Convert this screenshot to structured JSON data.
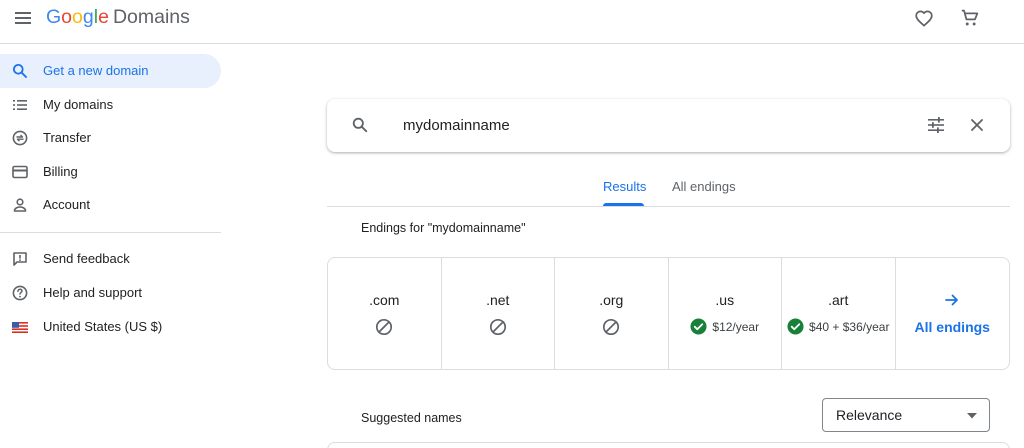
{
  "header": {
    "logo_letters": [
      {
        "char": "G",
        "color": "#4285F4"
      },
      {
        "char": "o",
        "color": "#EA4335"
      },
      {
        "char": "o",
        "color": "#FBBC05"
      },
      {
        "char": "g",
        "color": "#4285F4"
      },
      {
        "char": "l",
        "color": "#34A853"
      },
      {
        "char": "e",
        "color": "#EA4335"
      }
    ],
    "product_name": "Domains",
    "icons": [
      "menu-icon",
      "heart-icon",
      "cart-icon"
    ]
  },
  "sidebar": {
    "items": [
      {
        "label": "Get a new domain",
        "icon": "search-icon",
        "active": true
      },
      {
        "label": "My domains",
        "icon": "list-icon",
        "active": false
      },
      {
        "label": "Transfer",
        "icon": "transfer-icon",
        "active": false
      },
      {
        "label": "Billing",
        "icon": "credit-card-icon",
        "active": false
      },
      {
        "label": "Account",
        "icon": "person-icon",
        "active": false
      }
    ],
    "secondary_items": [
      {
        "label": "Send feedback",
        "icon": "feedback-icon"
      },
      {
        "label": "Help and support",
        "icon": "help-icon"
      },
      {
        "label": "United States (US $)",
        "icon": "us-flag-icon"
      }
    ]
  },
  "search": {
    "value": "mydomainname",
    "icons": [
      "search-icon",
      "tune-icon",
      "close-icon"
    ]
  },
  "tabs": [
    {
      "label": "Results",
      "active": true
    },
    {
      "label": "All endings",
      "active": false
    }
  ],
  "endings": {
    "heading": "Endings for \"mydomainname\"",
    "items": [
      {
        "name": ".com",
        "available": false,
        "price": ""
      },
      {
        "name": ".net",
        "available": false,
        "price": ""
      },
      {
        "name": ".org",
        "available": false,
        "price": ""
      },
      {
        "name": ".us",
        "available": true,
        "price": "$12/year"
      },
      {
        "name": ".art",
        "available": true,
        "price": "$40 + $36/year"
      }
    ],
    "all_endings_label": "All endings"
  },
  "suggested": {
    "heading": "Suggested names",
    "sort_selected": "Relevance"
  },
  "colors": {
    "accent": "#1a73e8",
    "active_bg": "#e8f0fe",
    "available_green": "#188038",
    "divider": "#dadce0"
  }
}
